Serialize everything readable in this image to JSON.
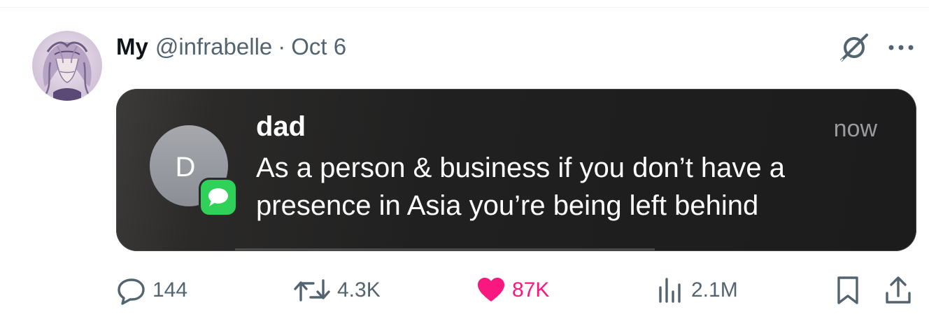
{
  "post": {
    "author": {
      "display_name": "My",
      "handle": "@infrabelle",
      "separator": "·",
      "date": "Oct 6"
    },
    "icons": {
      "avatar": "profile-picture",
      "grok": "grok-icon",
      "more": "more-icon"
    },
    "media": {
      "notification": {
        "avatar_initial": "D",
        "badge_icon": "messages-app-icon",
        "sender": "dad",
        "time": "now",
        "message": "As a person & business if you don’t have a presence in Asia you’re being left behind"
      }
    },
    "actions": {
      "replies": "144",
      "reposts": "4.3K",
      "likes": "87K",
      "views": "2.1M",
      "bookmark_icon": "bookmark-icon",
      "share_icon": "share-icon"
    },
    "colors": {
      "like_accent": "#f91880",
      "secondary_text": "#536471",
      "badge_green": "#30d158"
    }
  }
}
